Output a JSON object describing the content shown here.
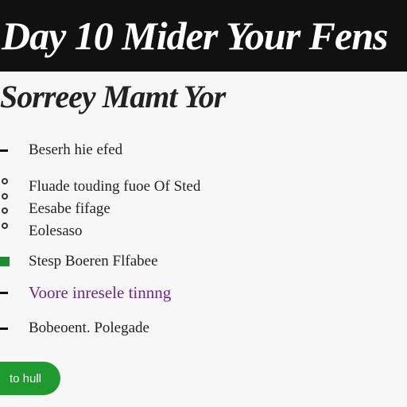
{
  "header": {
    "title": "Day 10 Mider Your Fens"
  },
  "section": {
    "title": "Sorreey Mamt Yor"
  },
  "items": [
    "Beserh hie efed",
    "Fluade touding fuoe Of Sted",
    "Eesabe fifage",
    "Eolesaso",
    "Stesp Boeren Flfabee",
    "Voore inresele tinnng",
    "Bobeoent. Polegade"
  ],
  "cta": {
    "label": "to hull"
  },
  "colors": {
    "header_bg": "#111111",
    "accent_green": "#1b8e2d",
    "link_purple": "#6a2a8a"
  }
}
